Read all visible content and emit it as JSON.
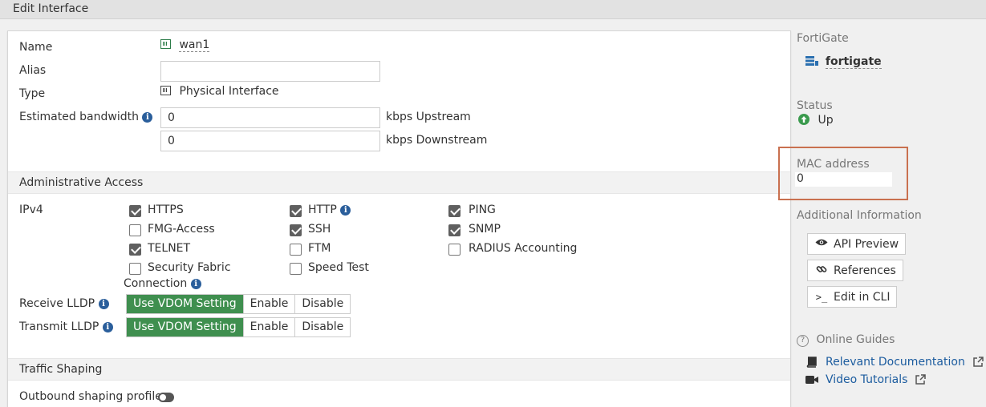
{
  "window": {
    "title": "Edit Interface"
  },
  "form": {
    "name_label": "Name",
    "name_value": "wan1",
    "alias_label": "Alias",
    "alias_value": "",
    "type_label": "Type",
    "type_value": "Physical Interface",
    "bandwidth_label": "Estimated bandwidth",
    "upstream_value": "0",
    "upstream_unit": "kbps Upstream",
    "downstream_value": "0",
    "downstream_unit": "kbps Downstream"
  },
  "admin_access": {
    "section_title": "Administrative Access",
    "ipv4_label": "IPv4",
    "options": [
      {
        "label": "HTTPS",
        "checked": true
      },
      {
        "label": "HTTP",
        "checked": true
      },
      {
        "label": "PING",
        "checked": true
      },
      {
        "label": "FMG-Access",
        "checked": false
      },
      {
        "label": "SSH",
        "checked": true
      },
      {
        "label": "SNMP",
        "checked": true
      },
      {
        "label": "TELNET",
        "checked": true
      },
      {
        "label": "FTM",
        "checked": false
      },
      {
        "label": "RADIUS Accounting",
        "checked": false
      },
      {
        "label": "Security Fabric",
        "label2": "Connection",
        "checked": false
      },
      {
        "label": "Speed Test",
        "checked": false
      }
    ],
    "receive_lldp_label": "Receive LLDP",
    "transmit_lldp_label": "Transmit LLDP",
    "lldp_options": [
      "Use VDOM Setting",
      "Enable",
      "Disable"
    ],
    "lldp_selected": "Use VDOM Setting"
  },
  "traffic_shaping": {
    "section_title": "Traffic Shaping",
    "outbound_label": "Outbound shaping profile",
    "outbound_enabled": false
  },
  "sidebar": {
    "device_label": "FortiGate",
    "device_name": "fortigate",
    "status_label": "Status",
    "status_value": "Up",
    "mac_label": "MAC address",
    "mac_value": "0",
    "additional_label": "Additional Information",
    "api_preview": "API Preview",
    "references": "References",
    "edit_cli": "Edit in CLI",
    "online_guides": "Online Guides",
    "relevant_docs": "Relevant Documentation",
    "video_tutorials": "Video Tutorials"
  },
  "colors": {
    "accent_green": "#3f8f4f",
    "link_blue": "#1c5c9f",
    "highlight_box": "#c9704f"
  }
}
